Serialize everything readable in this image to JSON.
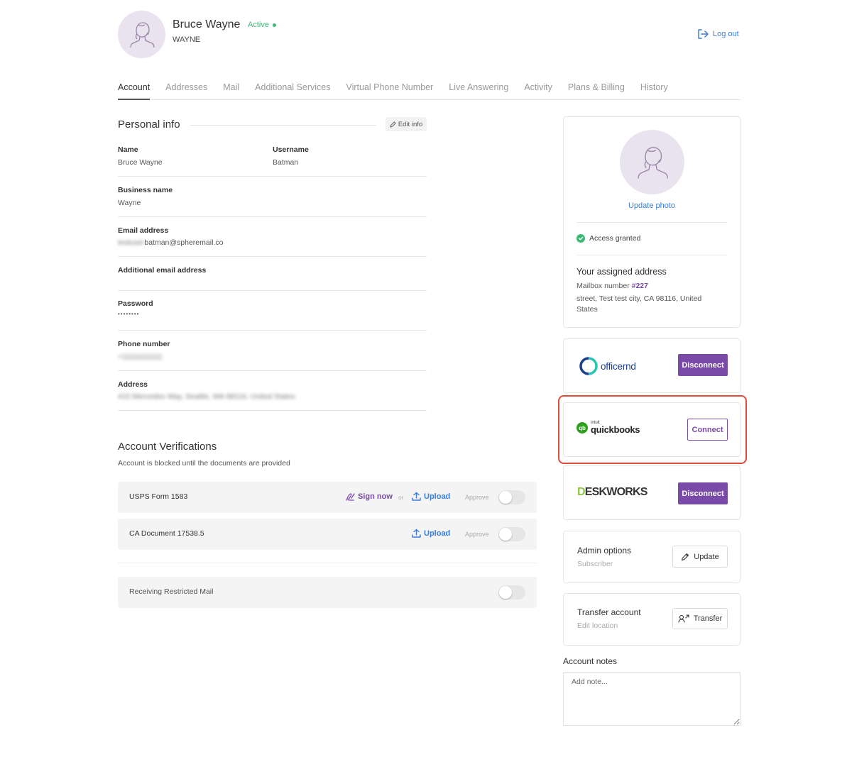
{
  "header": {
    "name": "Bruce Wayne",
    "status": "Active",
    "company": "WAYNE",
    "logout": "Log out"
  },
  "tabs": [
    {
      "label": "Account",
      "active": true
    },
    {
      "label": "Addresses"
    },
    {
      "label": "Mail"
    },
    {
      "label": "Additional Services"
    },
    {
      "label": "Virtual Phone Number"
    },
    {
      "label": "Live Answering"
    },
    {
      "label": "Activity"
    },
    {
      "label": "Plans & Billing"
    },
    {
      "label": "History"
    }
  ],
  "personal_info": {
    "title": "Personal info",
    "edit": "Edit info",
    "name_label": "Name",
    "name_value": "Bruce Wayne",
    "username_label": "Username",
    "username_value": "Batman",
    "business_label": "Business name",
    "business_value": "Wayne",
    "email_label": "Email address",
    "email_blurred": "testuser",
    "email_value": "batman@spheremail.co",
    "additional_email_label": "Additional email address",
    "password_label": "Password",
    "password_value": "••••••••",
    "phone_label": "Phone number",
    "phone_value": "+11111111111",
    "address_label": "Address",
    "address_value": "415 Mercedes Way, Seattle, WA 98116, United States"
  },
  "verifications": {
    "title": "Account Verifications",
    "subtitle": "Account is blocked until the documents are provided",
    "rows": [
      {
        "label": "USPS Form 1583",
        "sign": "Sign now",
        "or": "or",
        "upload": "Upload",
        "approve": "Approve"
      },
      {
        "label": "CA Document 17538.5",
        "upload": "Upload",
        "approve": "Approve"
      }
    ],
    "restricted": "Receiving Restricted Mail"
  },
  "profile_card": {
    "update_photo": "Update photo",
    "access": "Access granted",
    "address_title": "Your assigned address",
    "mailbox_prefix": "Mailbox number",
    "mailbox_number": "#227",
    "address": "street, Test test city, CA 98116, United States"
  },
  "integrations": [
    {
      "brand": "officernd",
      "button": "Disconnect"
    },
    {
      "brand_small": "intuit",
      "brand": "quickbooks",
      "button": "Connect"
    },
    {
      "brand": "DESKWORKS",
      "button": "Disconnect"
    }
  ],
  "admin": {
    "title": "Admin options",
    "subtitle": "Subscriber",
    "button": "Update"
  },
  "transfer": {
    "title": "Transfer account",
    "subtitle": "Edit location",
    "button": "Transfer"
  },
  "notes": {
    "label": "Account notes",
    "placeholder": "Add note..."
  },
  "colors": {
    "accent": "#7a4aa8",
    "link": "#3b7ddd",
    "success": "#3bb874",
    "highlight": "#e04b3a"
  }
}
